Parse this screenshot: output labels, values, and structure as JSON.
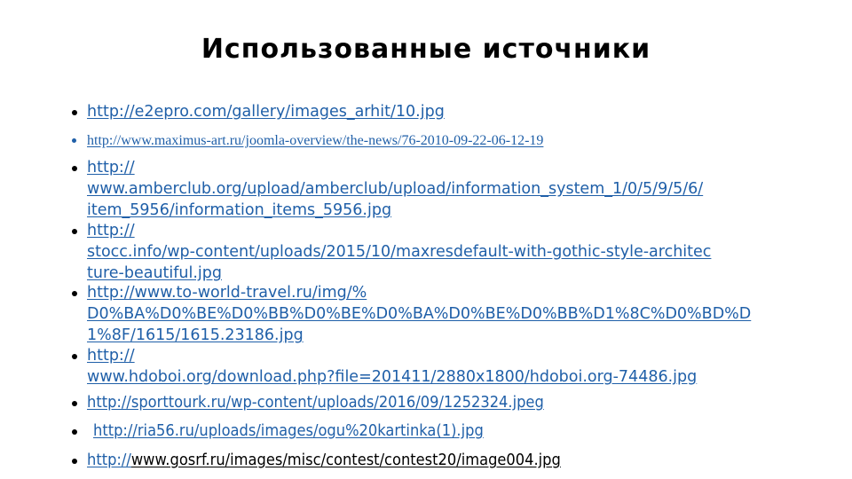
{
  "slide": {
    "title": "Использованные источники",
    "link_color": "#1f5fa8",
    "sources": [
      {
        "lines": [
          "http://e2epro.com/gallery/images_arhit/10.jpg"
        ]
      },
      {
        "lines": [
          "http://www.maximus-art.ru/joomla-overview/the-news/76-2010-09-22-06-12-19"
        ]
      },
      {
        "lines": [
          "http://",
          "www.amberclub.org/upload/amberclub/upload/information_system_1/0/5/9/5/6/",
          "item_5956/information_items_5956.jpg"
        ]
      },
      {
        "lines": [
          "http://",
          "stocc.info/wp-content/uploads/2015/10/maxresdefault-with-gothic-style-architec",
          "ture-beautiful.jpg"
        ]
      },
      {
        "lines": [
          "http://www.to-world-travel.ru/img/%",
          "D0%BA%D0%BE%D0%BB%D0%BE%D0%BA%D0%BE%D0%BB%D1%8C%D0%BD%D",
          "1%8F/1615/1615.23186.jpg"
        ]
      },
      {
        "lines": [
          "http://",
          "www.hdoboi.org/download.php?file=201411/2880x1800/hdoboi.org-74486.jpg"
        ]
      },
      {
        "lines": [
          "http://sporttourk.ru/wp-content/uploads/2016/09/1252324.jpeg"
        ]
      },
      {
        "lines": [
          "http://ria56.ru/uploads/images/ogu%20kartinka(1).jpg"
        ]
      },
      {
        "prefix": "http://",
        "rest": "www.gosrf.ru/images/misc/contest/contest20/image004.jpg"
      }
    ]
  }
}
